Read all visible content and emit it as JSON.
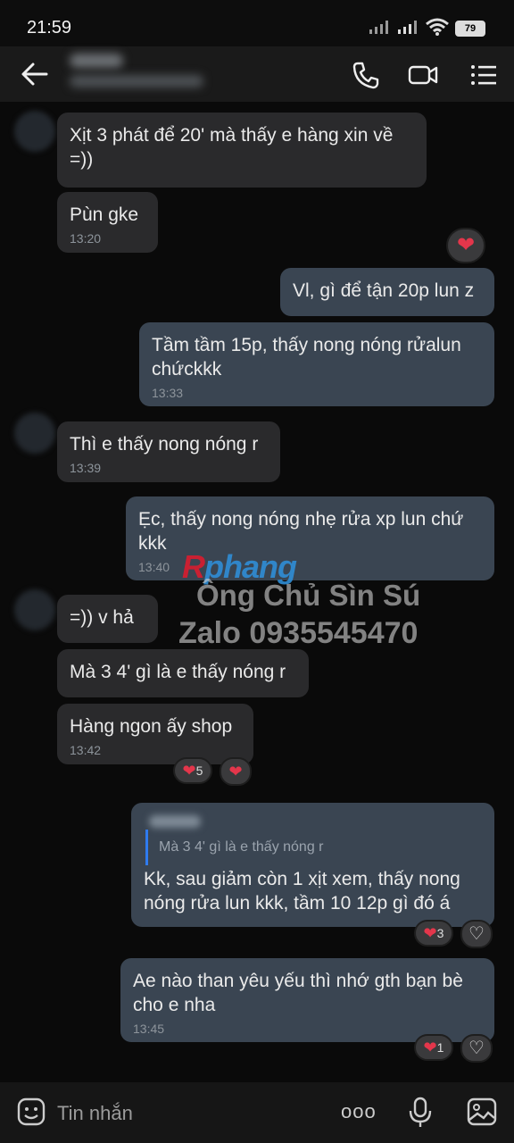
{
  "status": {
    "time": "21:59",
    "battery": "79"
  },
  "header": {
    "back_icon": "arrow-left-icon",
    "call_icon": "phone-icon",
    "video_icon": "video-camera-icon",
    "menu_icon": "list-menu-icon"
  },
  "messages": [
    {
      "dir": "in",
      "text": "Xịt 3 phát để 20' mà thấy e hàng xin về =))",
      "time": ""
    },
    {
      "dir": "in",
      "text": "Pùn gke",
      "time": "13:20"
    },
    {
      "dir": "out",
      "text": "Vl, gì để tận 20p lun z",
      "time": ""
    },
    {
      "dir": "out",
      "text": "Tầm tầm 15p, thấy nong nóng rửalun chứckkk",
      "time": "13:33"
    },
    {
      "dir": "in",
      "text": "Thì e thấy nong nóng r",
      "time": "13:39"
    },
    {
      "dir": "out",
      "text": "Ẹc, thấy nong nóng nhẹ rửa xp lun chứ kkk",
      "time": "13:40"
    },
    {
      "dir": "in",
      "text": "=)) v hả",
      "time": ""
    },
    {
      "dir": "in",
      "text": "Mà 3 4' gì là e thấy nóng r",
      "time": ""
    },
    {
      "dir": "in",
      "text": "Hàng ngon ấy shop",
      "time": "13:42"
    },
    {
      "dir": "out",
      "quote": "Mà 3 4' gì là e thấy nóng r",
      "text": "Kk, sau giảm còn 1 xịt xem, thấy nong nóng rửa lun kkk, tầm 10 12p gì đó á",
      "time": ""
    },
    {
      "dir": "out",
      "text": "Ae nào than yêu yếu thì nhớ gth bạn bè cho e nha",
      "time": "13:45"
    }
  ],
  "reactions": {
    "heart": "❤",
    "count_5": "5",
    "count_3": "3",
    "count_1": "1",
    "like": "♡"
  },
  "watermark": {
    "brand_a": "R",
    "brand_b": "phang",
    "line1": "Ông Chủ Sìn Sú",
    "line2": "Zalo 0935545470"
  },
  "input": {
    "placeholder": "Tin nhắn",
    "more": "ooo",
    "emoji_icon": "emoji-icon",
    "mic_icon": "mic-icon",
    "image_icon": "image-icon"
  },
  "colors": {
    "heart": "#e4364b",
    "incoming": "#2a2a2c",
    "outgoing": "#3a4552",
    "quote_bar": "#2f7bf0"
  }
}
